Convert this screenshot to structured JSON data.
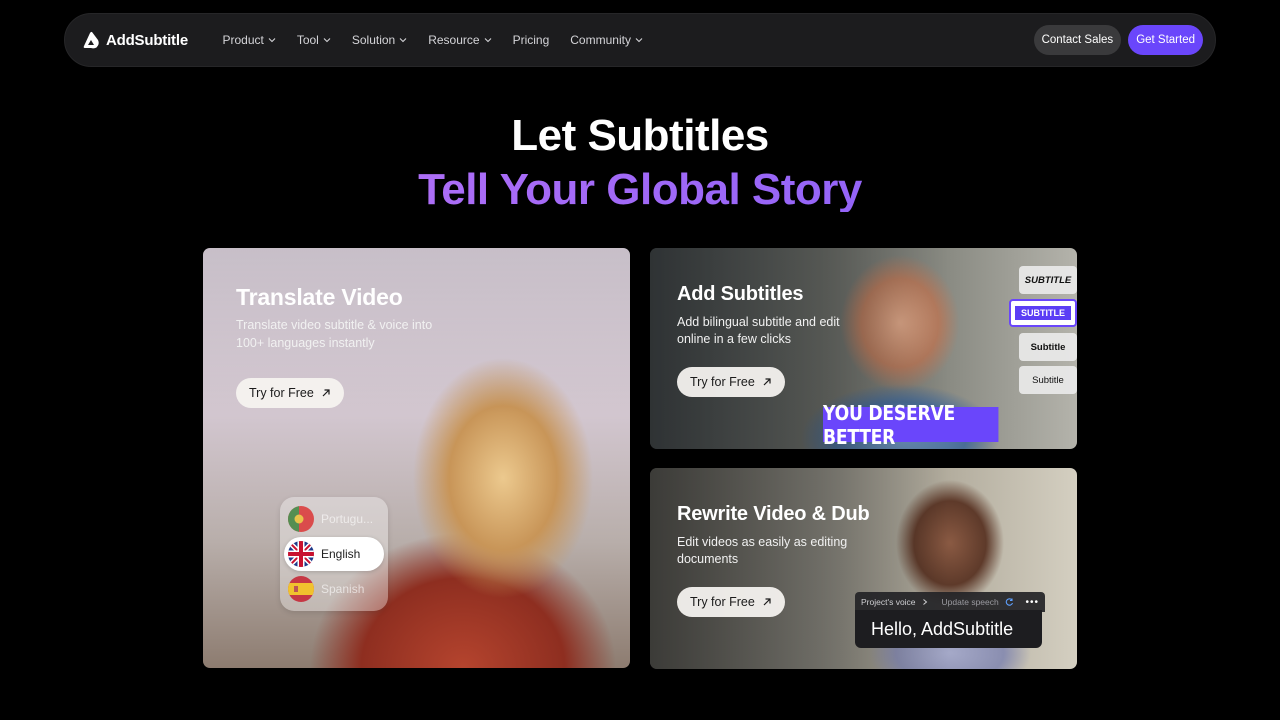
{
  "nav": {
    "logo": "AddSubtitle",
    "items": [
      {
        "label": "Product",
        "dropdown": true
      },
      {
        "label": "Tool",
        "dropdown": true
      },
      {
        "label": "Solution",
        "dropdown": true
      },
      {
        "label": "Resource",
        "dropdown": true
      },
      {
        "label": "Pricing",
        "dropdown": false
      },
      {
        "label": "Community",
        "dropdown": true
      }
    ],
    "contact_label": "Contact Sales",
    "start_label": "Get Started"
  },
  "hero": {
    "line1": "Let Subtitles",
    "line2": "Tell Your Global Story"
  },
  "cards": [
    {
      "title": "Translate Video",
      "desc_line1": "Translate video subtitle & voice into",
      "desc_line2": "100+ languages instantly",
      "cta": "Try for Free"
    },
    {
      "title": "Add Subtitles",
      "desc_line1": "Add bilingual subtitle and edit",
      "desc_line2": "online in a few clicks",
      "cta": "Try for Free"
    },
    {
      "title": "Rewrite Video & Dub",
      "desc_line1": "Edit videos as easily as editing",
      "desc_line2": "documents",
      "cta": "Try for Free"
    }
  ],
  "languages": [
    {
      "label": "Portugu...",
      "flag": "portugal-flag-icon"
    },
    {
      "label": "English",
      "flag": "uk-flag-icon"
    },
    {
      "label": "Spanish",
      "flag": "spain-flag-icon"
    }
  ],
  "subtitle_styles": [
    "SUBTITLE",
    "SUBTITLE",
    "Subtitle",
    "Subtitle"
  ],
  "banner_text": "YOU DESERVE BETTER",
  "dub": {
    "voice_label": "Project's voice",
    "update_label": "Update speech",
    "speech_text": "Hello, AddSubtitle"
  },
  "colors": {
    "accent": "#6a46fb",
    "nav_bg": "#1c1c1e",
    "gradient_start": "#c77cf4",
    "gradient_end": "#7d5cf8"
  }
}
